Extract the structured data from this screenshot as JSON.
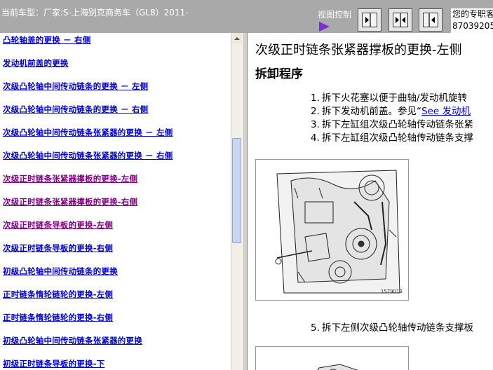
{
  "header": {
    "vehicle_label": "当前车型：厂家:S-上海别克商务车（GL8）2011-",
    "view_control_label": "视图控制",
    "contact_line1": "您的专职客",
    "contact_line2": "87039205"
  },
  "nav": {
    "items": [
      {
        "label": "凸轮轴盖的更换 － 右侧",
        "visited": false
      },
      {
        "label": "发动机前盖的更换",
        "visited": false
      },
      {
        "label": "次级凸轮轴中间传动链条的更换 － 左侧",
        "visited": false
      },
      {
        "label": "次级凸轮轴中间传动链条的更换 － 右侧",
        "visited": false
      },
      {
        "label": "次级凸轮轴中间传动链条张紧器的更换 － 左侧",
        "visited": false
      },
      {
        "label": "次级凸轮轴中间传动链条张紧器的更换 － 右侧",
        "visited": false
      },
      {
        "label": "次级正时链条张紧器撑板的更换-左侧",
        "visited": true
      },
      {
        "label": "次级正时链条张紧器撑板的更换-右侧",
        "visited": true
      },
      {
        "label": "次级正时链条导板的更换-左侧",
        "visited": true
      },
      {
        "label": "次级正时链条导板的更换-右侧",
        "visited": false
      },
      {
        "label": "初级凸轮轴中间传动链条的更换",
        "visited": false
      },
      {
        "label": "正时链条惰轮链轮的更换-左侧",
        "visited": false
      },
      {
        "label": "正时链条惰轮链轮的更换-右侧",
        "visited": false
      },
      {
        "label": "初级凸轮轴中间传动链条张紧器的更换",
        "visited": false
      },
      {
        "label": "初级正时链条导板的更换-下",
        "visited": false
      }
    ]
  },
  "doc": {
    "title": "次级正时链条张紧器撑板的更换-左侧",
    "subtitle": "拆卸程序",
    "steps": [
      {
        "num": "1.",
        "text": "拆下火花塞以便于曲轴/发动机旋转"
      },
      {
        "num": "2.",
        "text": "拆下发动机前盖。参见",
        "quote": "“",
        "link": "See 发动机"
      },
      {
        "num": "3.",
        "text": "拆下左缸组次级凸轮轴传动链条张紧"
      },
      {
        "num": "4.",
        "text": "拆下左缸组次级凸轮轴传动链条支撑"
      }
    ],
    "figure_code": "1579013",
    "step5": {
      "num": "5.",
      "text": "拆下左侧次级凸轮轴传动链条支撑板"
    }
  },
  "colors": {
    "topbar": "#a9a9a9",
    "link": "#0000cc",
    "visited_link": "#800080",
    "view_arrow": "#7b2fd6"
  }
}
